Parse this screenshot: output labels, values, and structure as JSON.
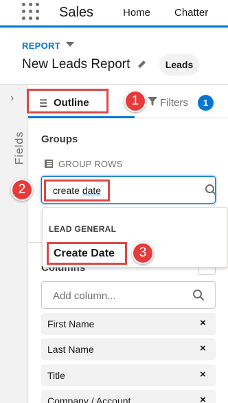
{
  "topnav": {
    "app_name": "Sales",
    "tabs": [
      {
        "label": "Home"
      },
      {
        "label": "Chatter"
      }
    ]
  },
  "header": {
    "eyebrow": "REPORT",
    "title": "New Leads Report",
    "report_type": "Leads"
  },
  "side_rail": {
    "label": "Fields",
    "chevron": "›"
  },
  "panel": {
    "tabs": {
      "outline_label": "Outline",
      "filters_label": "Filters",
      "filters_count": "1"
    },
    "groups": {
      "title": "Groups",
      "group_rows_label": "GROUP ROWS",
      "search_value_part1": "create ",
      "search_value_part2": "date"
    },
    "columns": {
      "title": "Columns",
      "add_placeholder": "Add column...",
      "items": [
        {
          "label": "First Name"
        },
        {
          "label": "Last Name"
        },
        {
          "label": "Title"
        },
        {
          "label": "Company / Account"
        }
      ],
      "remove_glyph": "×"
    }
  },
  "dropdown": {
    "section_header": "LEAD GENERAL",
    "option": "Create Date"
  },
  "annotations": {
    "markers": [
      "1",
      "2",
      "3"
    ],
    "color": "#e04646"
  },
  "colors": {
    "brand": "#0176d3",
    "annotation": "#e53b3b"
  },
  "icons": {
    "waffle": "app-launcher-icon",
    "pencil": "pencil-icon",
    "outline": "list-icon",
    "filter": "filter-icon",
    "search": "search-icon"
  }
}
